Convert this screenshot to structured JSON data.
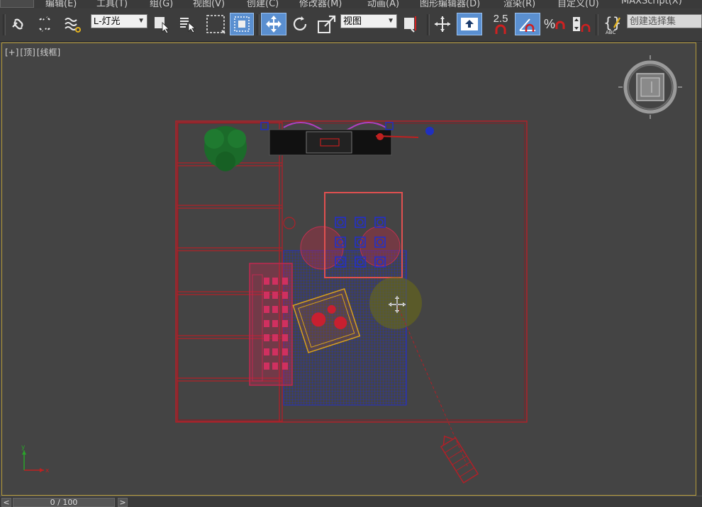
{
  "menu": {
    "items": [
      "编辑(E)",
      "工具(T)",
      "组(G)",
      "视图(V)",
      "创建(C)",
      "修改器(M)",
      "动画(A)",
      "图形编辑器(D)",
      "渲染(R)",
      "自定义(U)",
      "MAXScript(X)"
    ]
  },
  "toolbar": {
    "layer_select": "L-灯光",
    "coord_select": "视图",
    "snap_angle_label": "2.5",
    "percent_label": "%",
    "selection_set_placeholder": "创建选择集"
  },
  "viewport": {
    "label_plus": "[+]",
    "label_view": "[顶]",
    "label_shading": "[线框]"
  },
  "timeline": {
    "frame_display": "0 / 100",
    "prev_arrow": "<",
    "next_arrow": ">"
  },
  "colors": {
    "viewport_bg": "#444444",
    "border_active": "#b59b3a",
    "wire_red": "#c0202a",
    "wire_blue": "#2430c8",
    "selection_rect": "#e05050",
    "active_button": "#5a8fd0"
  }
}
